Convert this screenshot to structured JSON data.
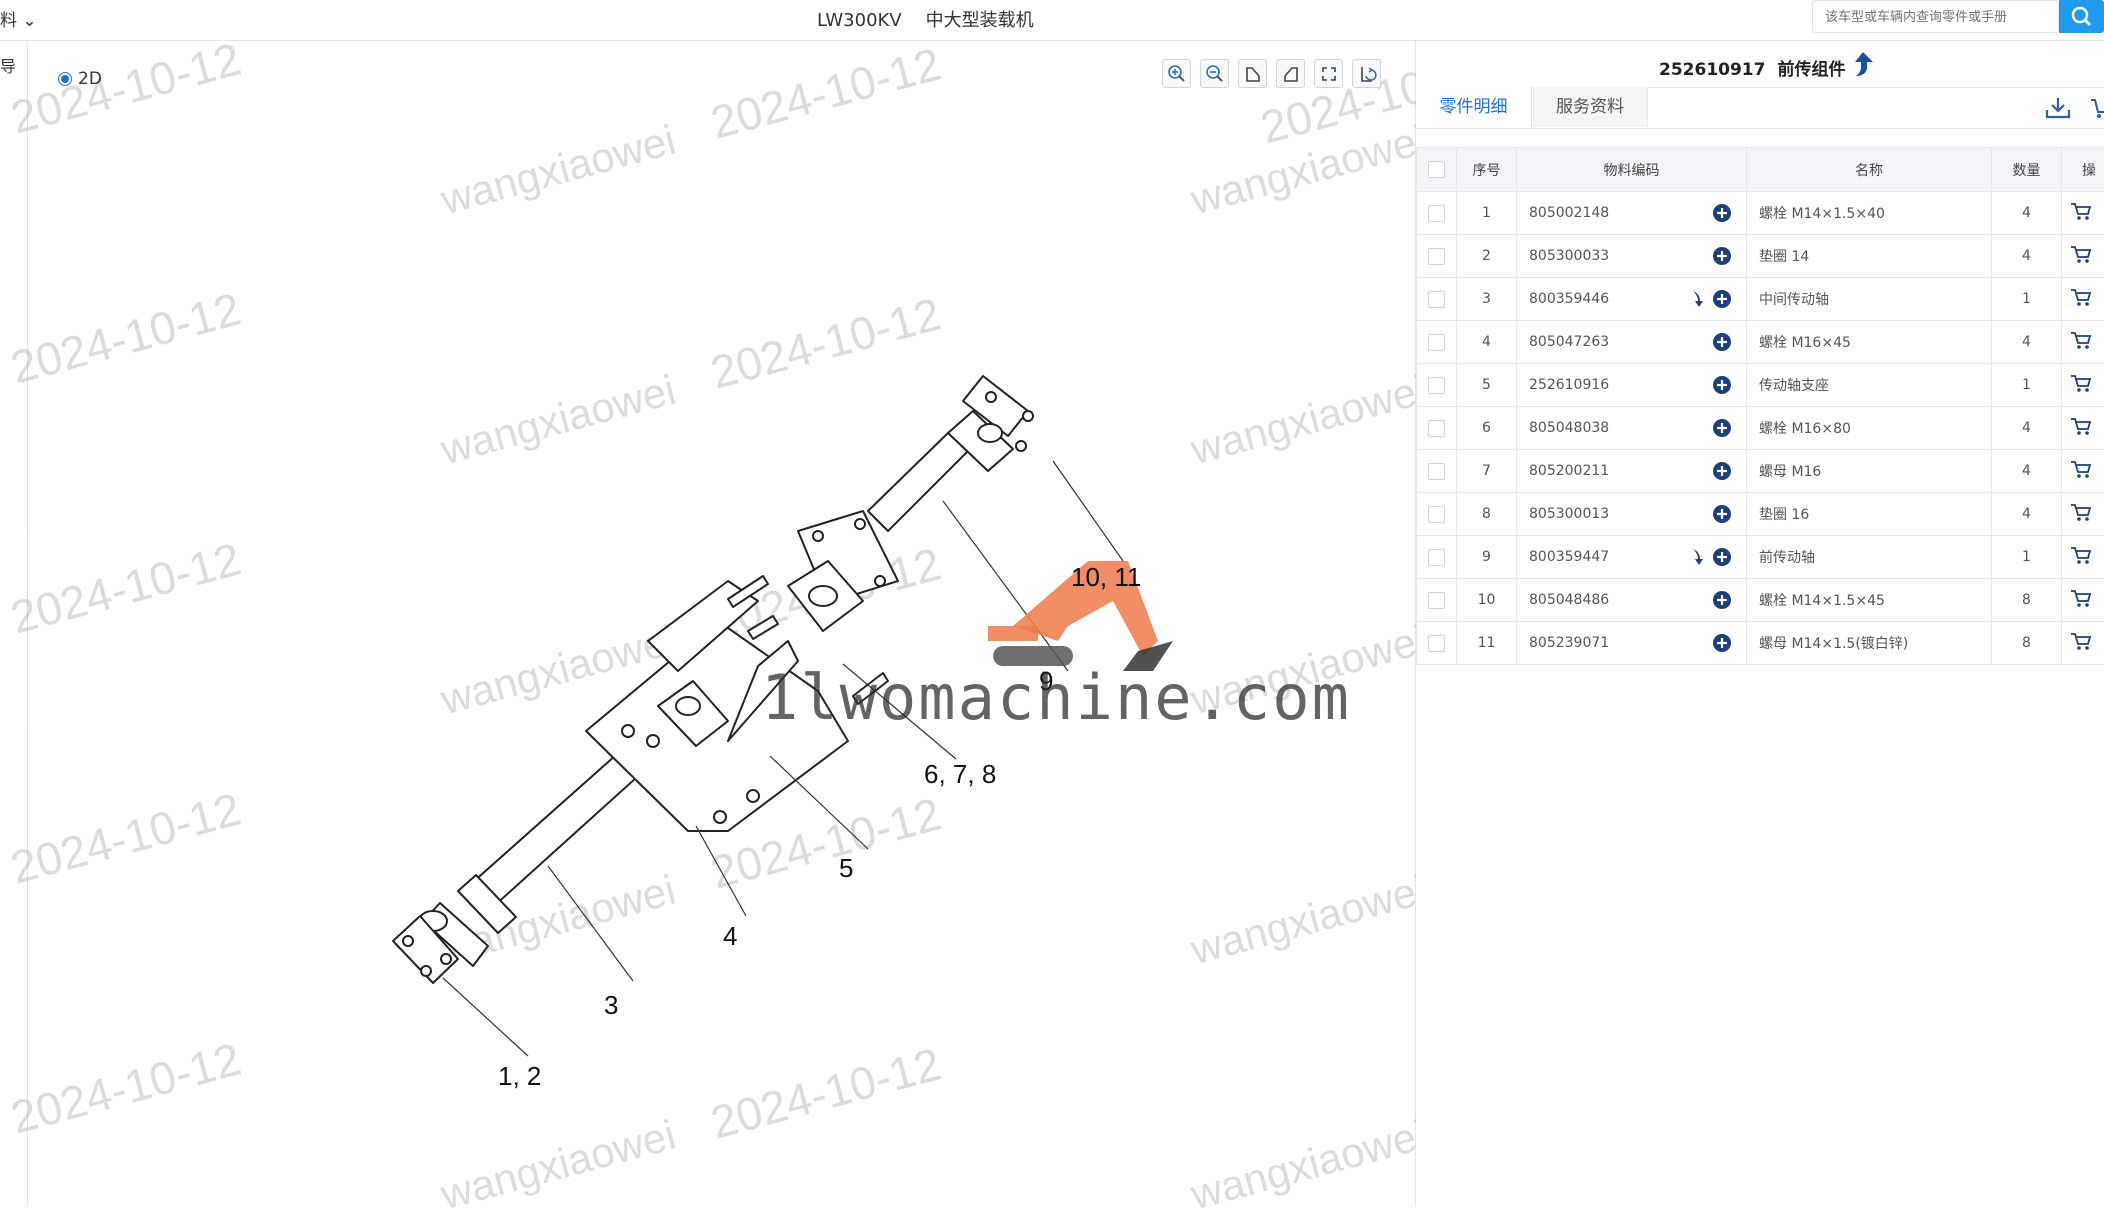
{
  "header": {
    "left_crumb": "料 ⌄",
    "model": "LW300KV",
    "category": "中大型装载机",
    "search_placeholder": "该车型或车辆内查询零件或手册"
  },
  "left_strip": {
    "guide_label": "导"
  },
  "viewer": {
    "mode_label": "2D",
    "tools": [
      "zoom-in-icon",
      "zoom-out-icon",
      "rotate-left-icon",
      "rotate-right-icon",
      "fit-screen-icon",
      "reset-view-icon"
    ],
    "callouts": [
      "10, 11",
      "9",
      "6, 7, 8",
      "5",
      "4",
      "3",
      "1, 2"
    ],
    "watermark_date": "2024-10-12",
    "watermark_user": "wangxiaowei",
    "site_mark": "1lwomachine.com",
    "logo_color": "#f07a4a"
  },
  "panel": {
    "assembly_code": "252610917",
    "assembly_name": "前传组件",
    "tabs": [
      "零件明细",
      "服务资料"
    ],
    "columns": [
      "序号",
      "物料编码",
      "名称",
      "数量",
      "操"
    ],
    "rows": [
      {
        "seq": "1",
        "code": "805002148",
        "name": "螺栓 M14×1.5×40",
        "qty": "4",
        "has_sub": false
      },
      {
        "seq": "2",
        "code": "805300033",
        "name": "垫圈 14",
        "qty": "4",
        "has_sub": false
      },
      {
        "seq": "3",
        "code": "800359446",
        "name": "中间传动轴",
        "qty": "1",
        "has_sub": true
      },
      {
        "seq": "4",
        "code": "805047263",
        "name": "螺栓 M16×45",
        "qty": "4",
        "has_sub": false
      },
      {
        "seq": "5",
        "code": "252610916",
        "name": "传动轴支座",
        "qty": "1",
        "has_sub": false
      },
      {
        "seq": "6",
        "code": "805048038",
        "name": "螺栓 M16×80",
        "qty": "4",
        "has_sub": false
      },
      {
        "seq": "7",
        "code": "805200211",
        "name": "螺母 M16",
        "qty": "4",
        "has_sub": false
      },
      {
        "seq": "8",
        "code": "805300013",
        "name": "垫圈 16",
        "qty": "4",
        "has_sub": false
      },
      {
        "seq": "9",
        "code": "800359447",
        "name": "前传动轴",
        "qty": "1",
        "has_sub": true
      },
      {
        "seq": "10",
        "code": "805048486",
        "name": "螺栓 M14×1.5×45",
        "qty": "8",
        "has_sub": false
      },
      {
        "seq": "11",
        "code": "805239071",
        "name": "螺母 M14×1.5(镀白锌)",
        "qty": "8",
        "has_sub": false
      }
    ]
  },
  "colors": {
    "accent": "#1e73d8",
    "search_button": "#1e9bf0",
    "add_icon": "#1d3f7a"
  }
}
